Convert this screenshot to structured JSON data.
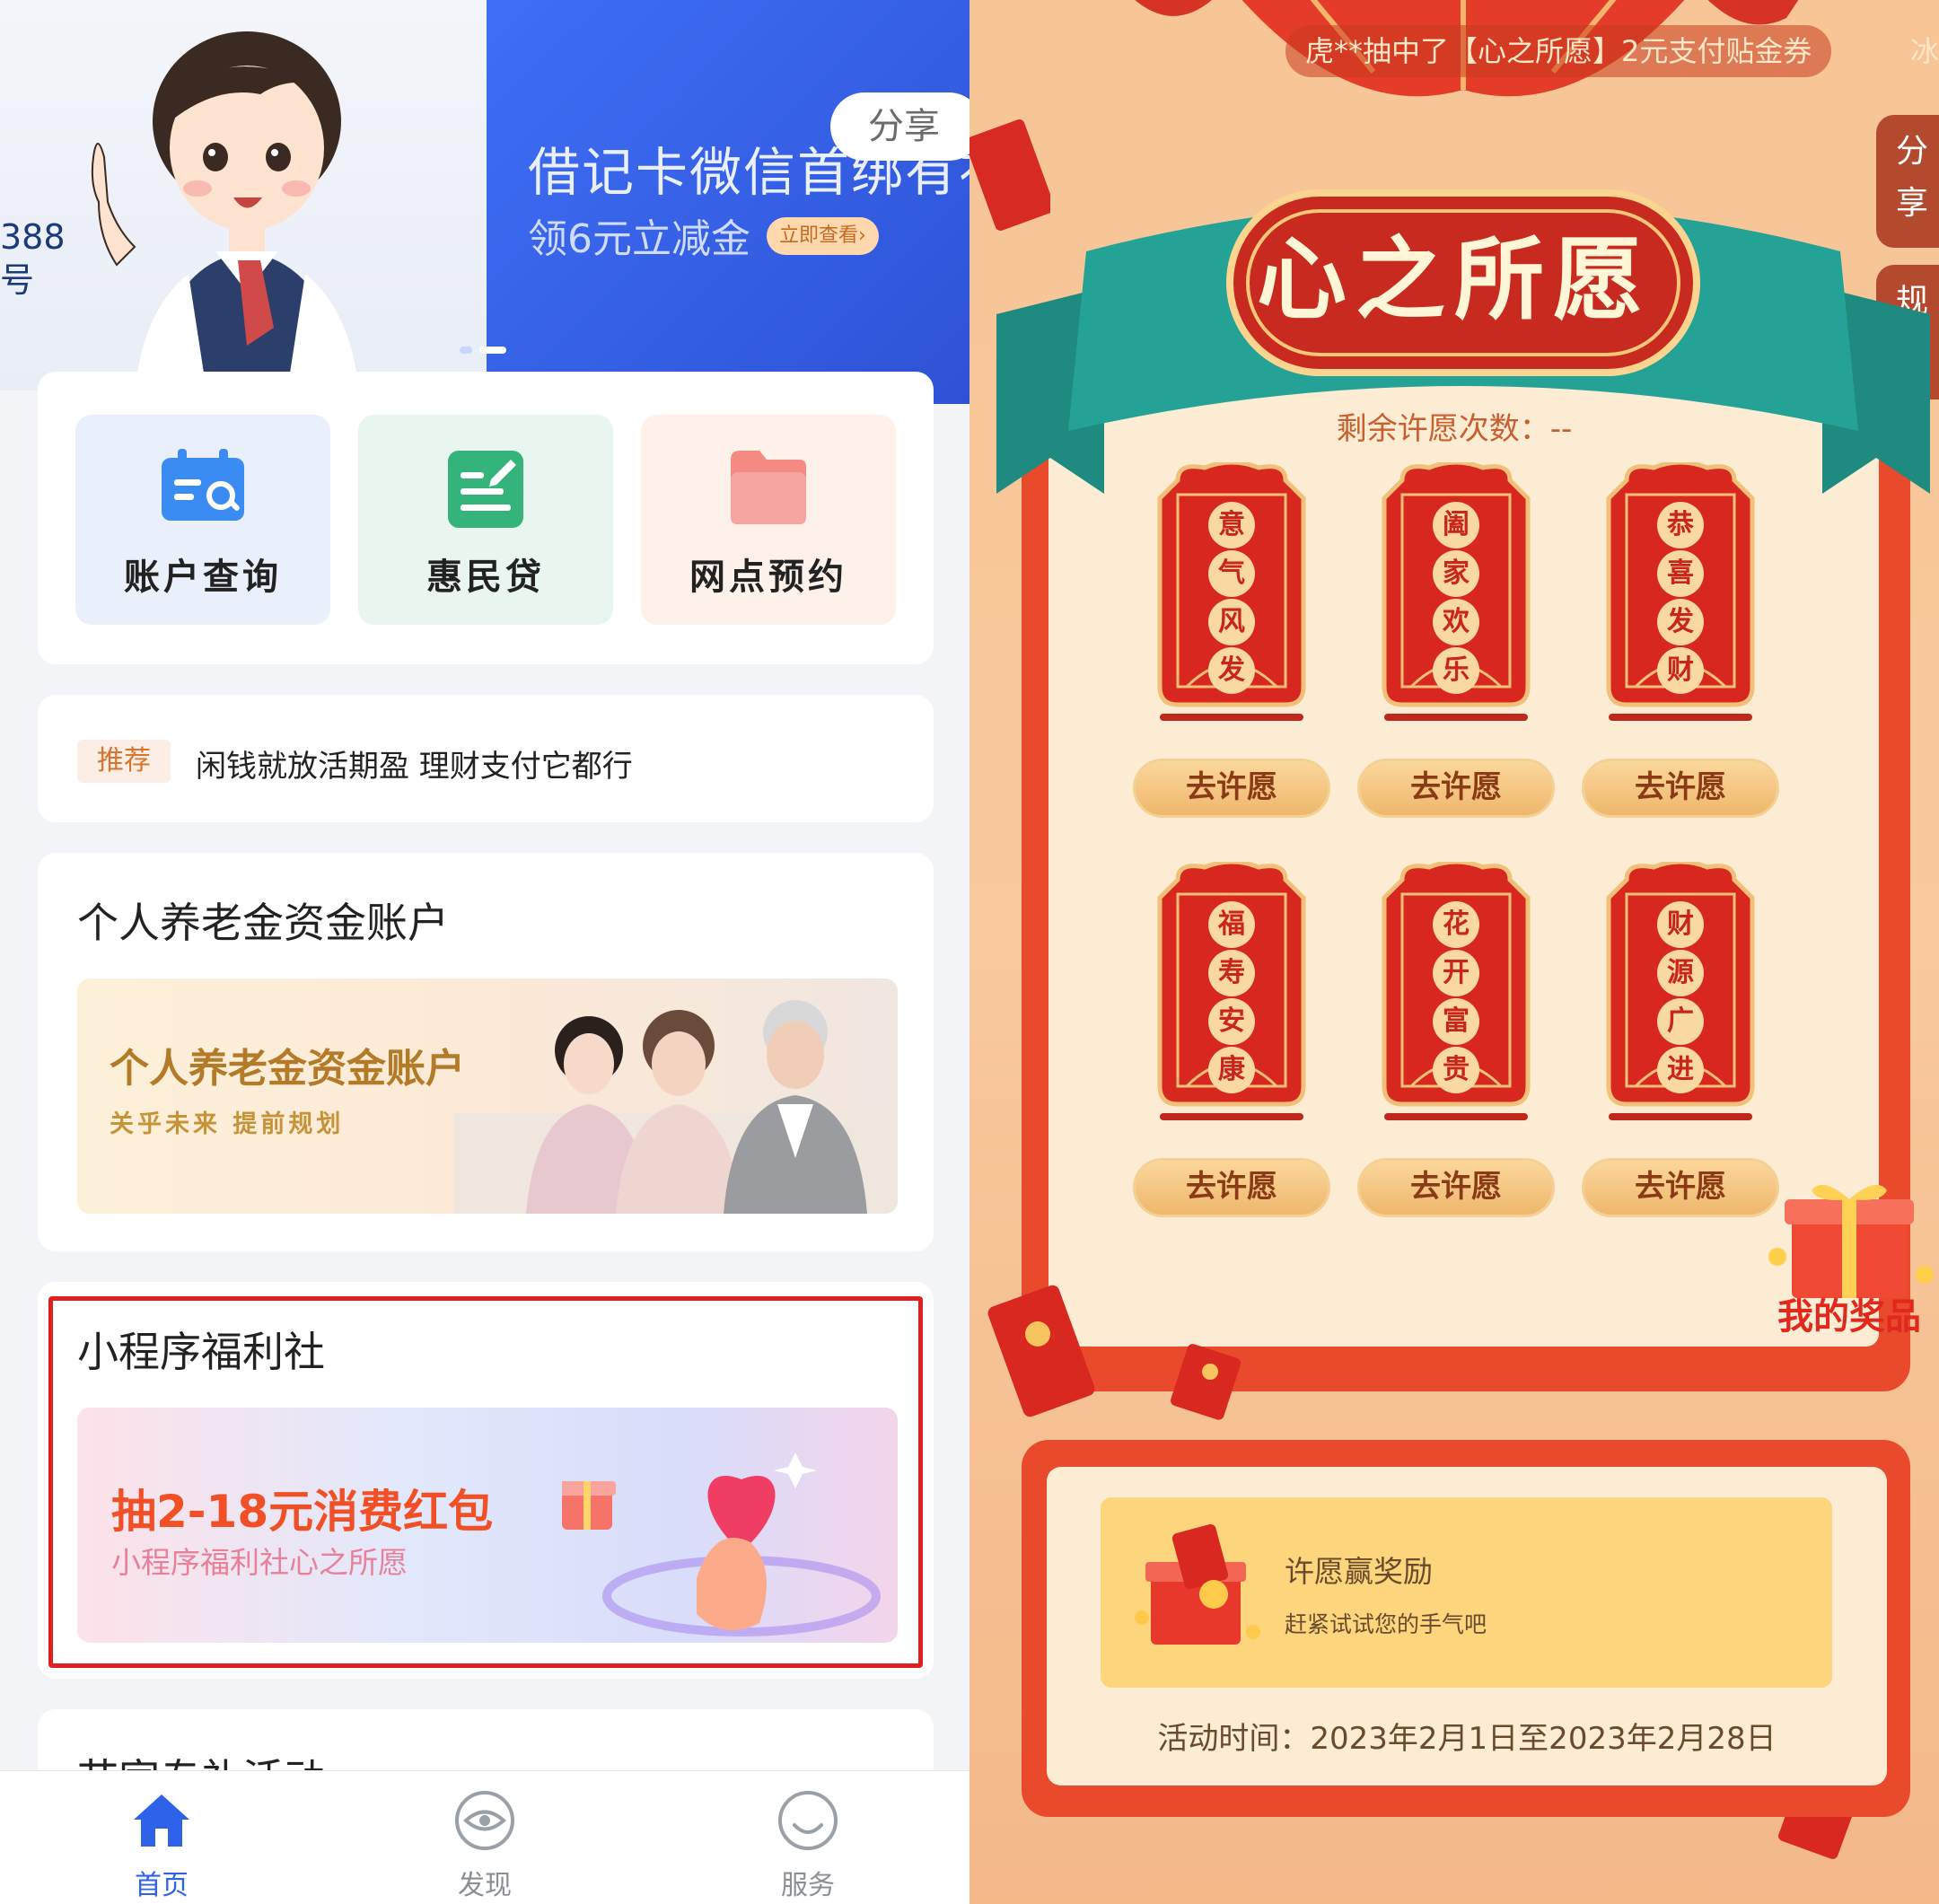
{
  "left": {
    "banner_left": {
      "phone_fragment": "388\n号"
    },
    "banner_right": {
      "title": "借记卡微信首绑有礼",
      "subtitle": "领6元立减金",
      "view_button": "立即查看›"
    },
    "share_label": "分享",
    "quick_actions": [
      {
        "label": "账户查询",
        "icon": "calendar-search-icon",
        "bg": "#eaf0fb"
      },
      {
        "label": "惠民贷",
        "icon": "document-edit-icon",
        "bg": "#e8f6ef"
      },
      {
        "label": "网点预约",
        "icon": "folder-icon",
        "bg": "#fdf1ea"
      }
    ],
    "recommend": {
      "tag": "推荐",
      "text": "闲钱就放活期盈 理财支付它都行"
    },
    "pension": {
      "title": "个人养老金资金账户",
      "banner_title": "个人养老金资金账户",
      "banner_sub": "关乎未来 提前规划"
    },
    "welfare": {
      "title": "小程序福利社",
      "banner_title": "抽2-18元消费红包",
      "banner_sub": "小程序福利社心之所愿"
    },
    "activity": {
      "title": "节家专礼活动"
    },
    "tabs": [
      {
        "label": "首页",
        "icon": "home-icon",
        "active": true
      },
      {
        "label": "发现",
        "icon": "discover-eye-icon",
        "active": false
      },
      {
        "label": "服务",
        "icon": "service-smile-icon",
        "active": false
      }
    ]
  },
  "right": {
    "ticker": "虎**抽中了【心之所愿】2元支付贴金券",
    "ticker_next": "冰",
    "side": {
      "share": "分享",
      "rules": "规则"
    },
    "title": "心之所愿",
    "remaining_label": "剩余许愿次数：--",
    "charms": [
      {
        "glyphs": [
          "意",
          "气",
          "风",
          "发"
        ],
        "button": "去许愿"
      },
      {
        "glyphs": [
          "阖",
          "家",
          "欢",
          "乐"
        ],
        "button": "去许愿"
      },
      {
        "glyphs": [
          "恭",
          "喜",
          "发",
          "财"
        ],
        "button": "去许愿"
      },
      {
        "glyphs": [
          "福",
          "寿",
          "安",
          "康"
        ],
        "button": "去许愿"
      },
      {
        "glyphs": [
          "花",
          "开",
          "富",
          "贵"
        ],
        "button": "去许愿"
      },
      {
        "glyphs": [
          "财",
          "源",
          "广",
          "进"
        ],
        "button": "去许愿"
      }
    ],
    "my_prizes": "我的奖品",
    "reward": {
      "title": "许愿赢奖励",
      "subtitle": "赶紧试试您的手气吧"
    },
    "activity_time": "活动时间：2023年2月1日至2023年2月28日"
  },
  "colors": {
    "brand_blue": "#2e5ff0",
    "festive_red": "#e0281e",
    "gold": "#f7c36e"
  }
}
